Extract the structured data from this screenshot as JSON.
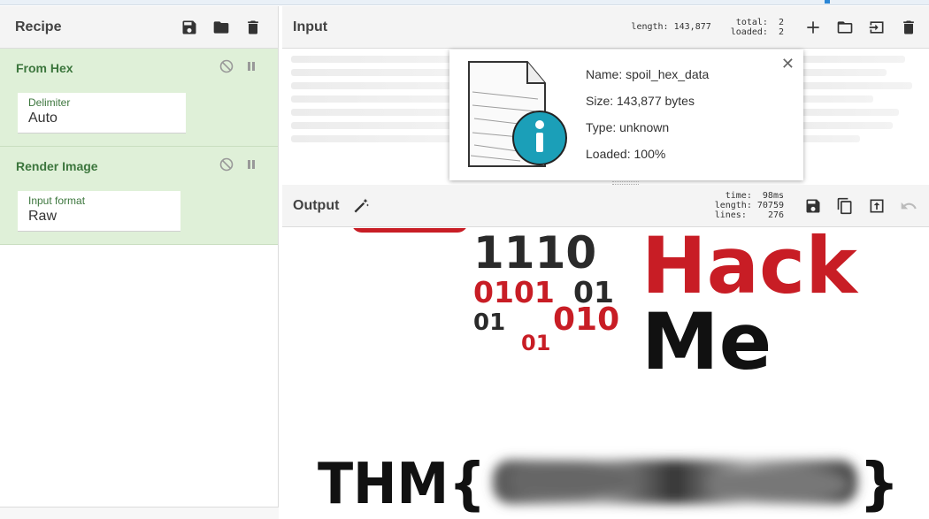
{
  "recipe": {
    "title": "Recipe",
    "icons": [
      "save-icon",
      "folder-icon",
      "trash-icon"
    ],
    "operations": [
      {
        "name": "From Hex",
        "arg_label": "Delimiter",
        "arg_value": "Auto"
      },
      {
        "name": "Render Image",
        "arg_label": "Input format",
        "arg_value": "Raw"
      }
    ]
  },
  "input": {
    "title": "Input",
    "length_label": "length:",
    "length_value": "143,877",
    "total_label": "total:",
    "total_value": "2",
    "loaded_label": "loaded:",
    "loaded_value": "2",
    "icons": [
      "plus-icon",
      "folder-icon",
      "sign-in-icon",
      "trash-icon"
    ],
    "file": {
      "name": "Name: spoil_hex_data",
      "size": "Size: 143,877 bytes",
      "type": "Type: unknown",
      "loaded": "Loaded: 100%"
    }
  },
  "output": {
    "title": "Output",
    "time_label": "time:",
    "time_value": "98ms",
    "length_label": "length:",
    "length_value": "70759",
    "lines_label": "lines:",
    "lines_value": "276",
    "icons": [
      "save-icon",
      "copy-icon",
      "move-to-input-icon",
      "undo-icon"
    ],
    "image": {
      "bits_line1": "1110",
      "bits_line2a": "0101",
      "bits_line2b": "01",
      "bits_line3a": "01",
      "bits_line3b": "010",
      "bits_line4": "01",
      "word_hack": "Hack",
      "word_me": "Me",
      "flag_prefix": "THM{",
      "flag_suffix": "}"
    }
  },
  "colors": {
    "op_bg": "#dff0d8",
    "op_text": "#3c763d",
    "brand_red": "#c81d25",
    "accent_blue": "#2a86d6"
  }
}
